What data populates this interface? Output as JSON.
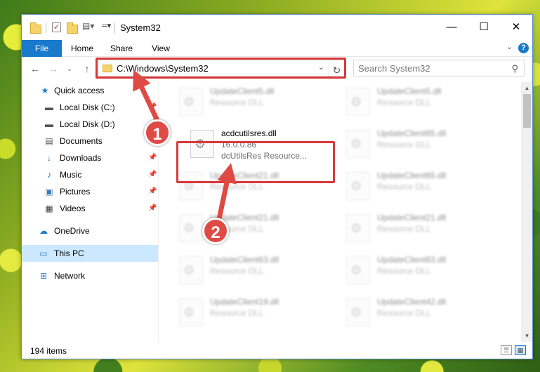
{
  "window": {
    "title": "System32",
    "controls": {
      "minimize": "—",
      "maximize": "☐",
      "close": "✕"
    }
  },
  "ribbon": {
    "tabs": [
      "File",
      "Home",
      "Share",
      "View"
    ],
    "help": "?"
  },
  "address": {
    "path": "C:\\Windows\\System32",
    "search_placeholder": "Search System32"
  },
  "sidebar": {
    "items": [
      {
        "label": "Quick access",
        "icon": "star-icon",
        "pinned": false
      },
      {
        "label": "Local Disk (C:)",
        "icon": "drive-icon",
        "pinned": true
      },
      {
        "label": "Local Disk (D:)",
        "icon": "drive-icon",
        "pinned": true
      },
      {
        "label": "Documents",
        "icon": "document-icon",
        "pinned": true
      },
      {
        "label": "Downloads",
        "icon": "download-icon",
        "pinned": true
      },
      {
        "label": "Music",
        "icon": "music-icon",
        "pinned": true
      },
      {
        "label": "Pictures",
        "icon": "pictures-icon",
        "pinned": true
      },
      {
        "label": "Videos",
        "icon": "video-icon",
        "pinned": true
      },
      {
        "label": "OneDrive",
        "icon": "cloud-icon",
        "pinned": false
      },
      {
        "label": "This PC",
        "icon": "computer-icon",
        "pinned": false,
        "selected": true
      },
      {
        "label": "Network",
        "icon": "network-icon",
        "pinned": false
      }
    ]
  },
  "files": {
    "highlighted": {
      "name": "acdcutilsres.dll",
      "version": "16.0.0.86",
      "description": "dcUtilsRes Resource..."
    },
    "left_column": [
      {
        "name": "UpdateClient5.dll",
        "description": "Resource DLL"
      },
      {
        "name": "UpdateClient21.dll",
        "description": "Resource DLL"
      },
      {
        "name": "UpdateClient21.dll",
        "description": "Resource DLL"
      },
      {
        "name": "UpdateClient63.dll",
        "description": "Resource DLL"
      },
      {
        "name": "UpdateClient19.dll",
        "description": "Resource DLL"
      }
    ],
    "right_column": [
      {
        "name": "UpdateClient5.dll",
        "description": "Resource DLL"
      },
      {
        "name": "UpdateClient65.dll",
        "description": "Resource DLL"
      },
      {
        "name": "UpdateClient65.dll",
        "description": "Resource DLL"
      },
      {
        "name": "UpdateClient21.dll",
        "description": "Resource DLL"
      },
      {
        "name": "UpdateClient63.dll",
        "description": "Resource DLL"
      },
      {
        "name": "UpdateClient42.dll",
        "description": "Resource DLL"
      }
    ]
  },
  "status": {
    "items_count": "194 items"
  },
  "callouts": [
    "1",
    "2"
  ],
  "colors": {
    "accent": "#1979ca",
    "highlight": "#d9393a",
    "callout": "#e04a45",
    "selected": "#cce8ff"
  }
}
